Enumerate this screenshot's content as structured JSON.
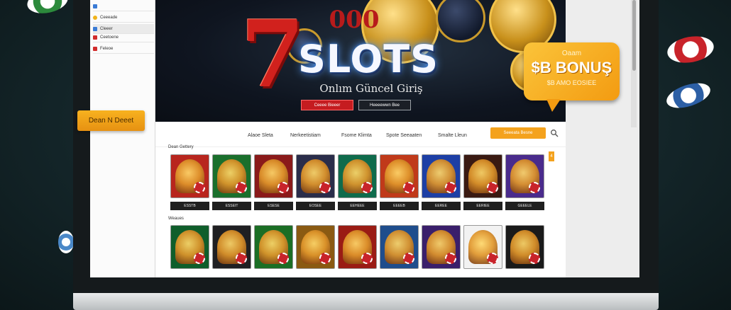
{
  "sidebar": {
    "items": [
      {
        "label": "",
        "icon": "mail-icon",
        "color": "#3a7bd5"
      },
      {
        "label": "Ceeeade",
        "icon": "yellow-dot-icon",
        "color": "#f0b21a"
      },
      {
        "label": "Cleeer",
        "icon": "blue-square-icon",
        "color": "#3a7bd5"
      },
      {
        "label": "Ceetoene",
        "icon": "red-flag-icon",
        "color": "#d12b2b"
      },
      {
        "label": "Feleoe",
        "icon": "red-square-icon",
        "color": "#d12b2b"
      },
      {
        "label": "Fenoe",
        "icon": "print-icon",
        "color": "#555555"
      }
    ]
  },
  "hero": {
    "title": "SLOTS",
    "subtitle": "Onlım Güncel Giriş",
    "coin_text": "000",
    "button_primary": "Ceeee Bieeer",
    "button_secondary": "Heeeewwn Bee"
  },
  "tag": {
    "label": "Dean N Deeet"
  },
  "nav": {
    "items": [
      "Alaoe Sleta",
      "Nerkeetistiam",
      "Fsome Klimta",
      "Spote Seeaaten",
      "Smalte Lleun"
    ],
    "cta": "Seeeata Besne",
    "search_icon": "search-icon"
  },
  "sections": {
    "first": "Dean Gettery",
    "second": "Weaues"
  },
  "games_row1": [
    {
      "label": "ESSTB",
      "bg": "#b8261e"
    },
    {
      "label": "ESSEIT",
      "bg": "#1a6f2c"
    },
    {
      "label": "ESESE",
      "bg": "#8a1a1a"
    },
    {
      "label": "EOSEE",
      "bg": "#2a2d4a"
    },
    {
      "label": "EEHEEE",
      "bg": "#0f6b4c"
    },
    {
      "label": "EEEEB",
      "bg": "#c03a1a"
    },
    {
      "label": "EEREE",
      "bg": "#1d3fa5"
    },
    {
      "label": "EERIEE",
      "bg": "#3a1a12"
    },
    {
      "label": "GEEELE",
      "bg": "#4a2b8c"
    }
  ],
  "games_row2": [
    {
      "bg": "#0f5e2b"
    },
    {
      "bg": "#1f1f22"
    },
    {
      "bg": "#1b6e25"
    },
    {
      "bg": "#8a5a12"
    },
    {
      "bg": "#9a1c14"
    },
    {
      "bg": "#1f4d8c"
    },
    {
      "bg": "#3a1f6b"
    },
    {
      "bg": "#f2f2f2"
    },
    {
      "bg": "#1a1a1a"
    }
  ],
  "badge": "4",
  "bonus": {
    "top": "Oaam",
    "main": "$B BONUŞ",
    "sub": "$B AMO EOSIEE"
  }
}
